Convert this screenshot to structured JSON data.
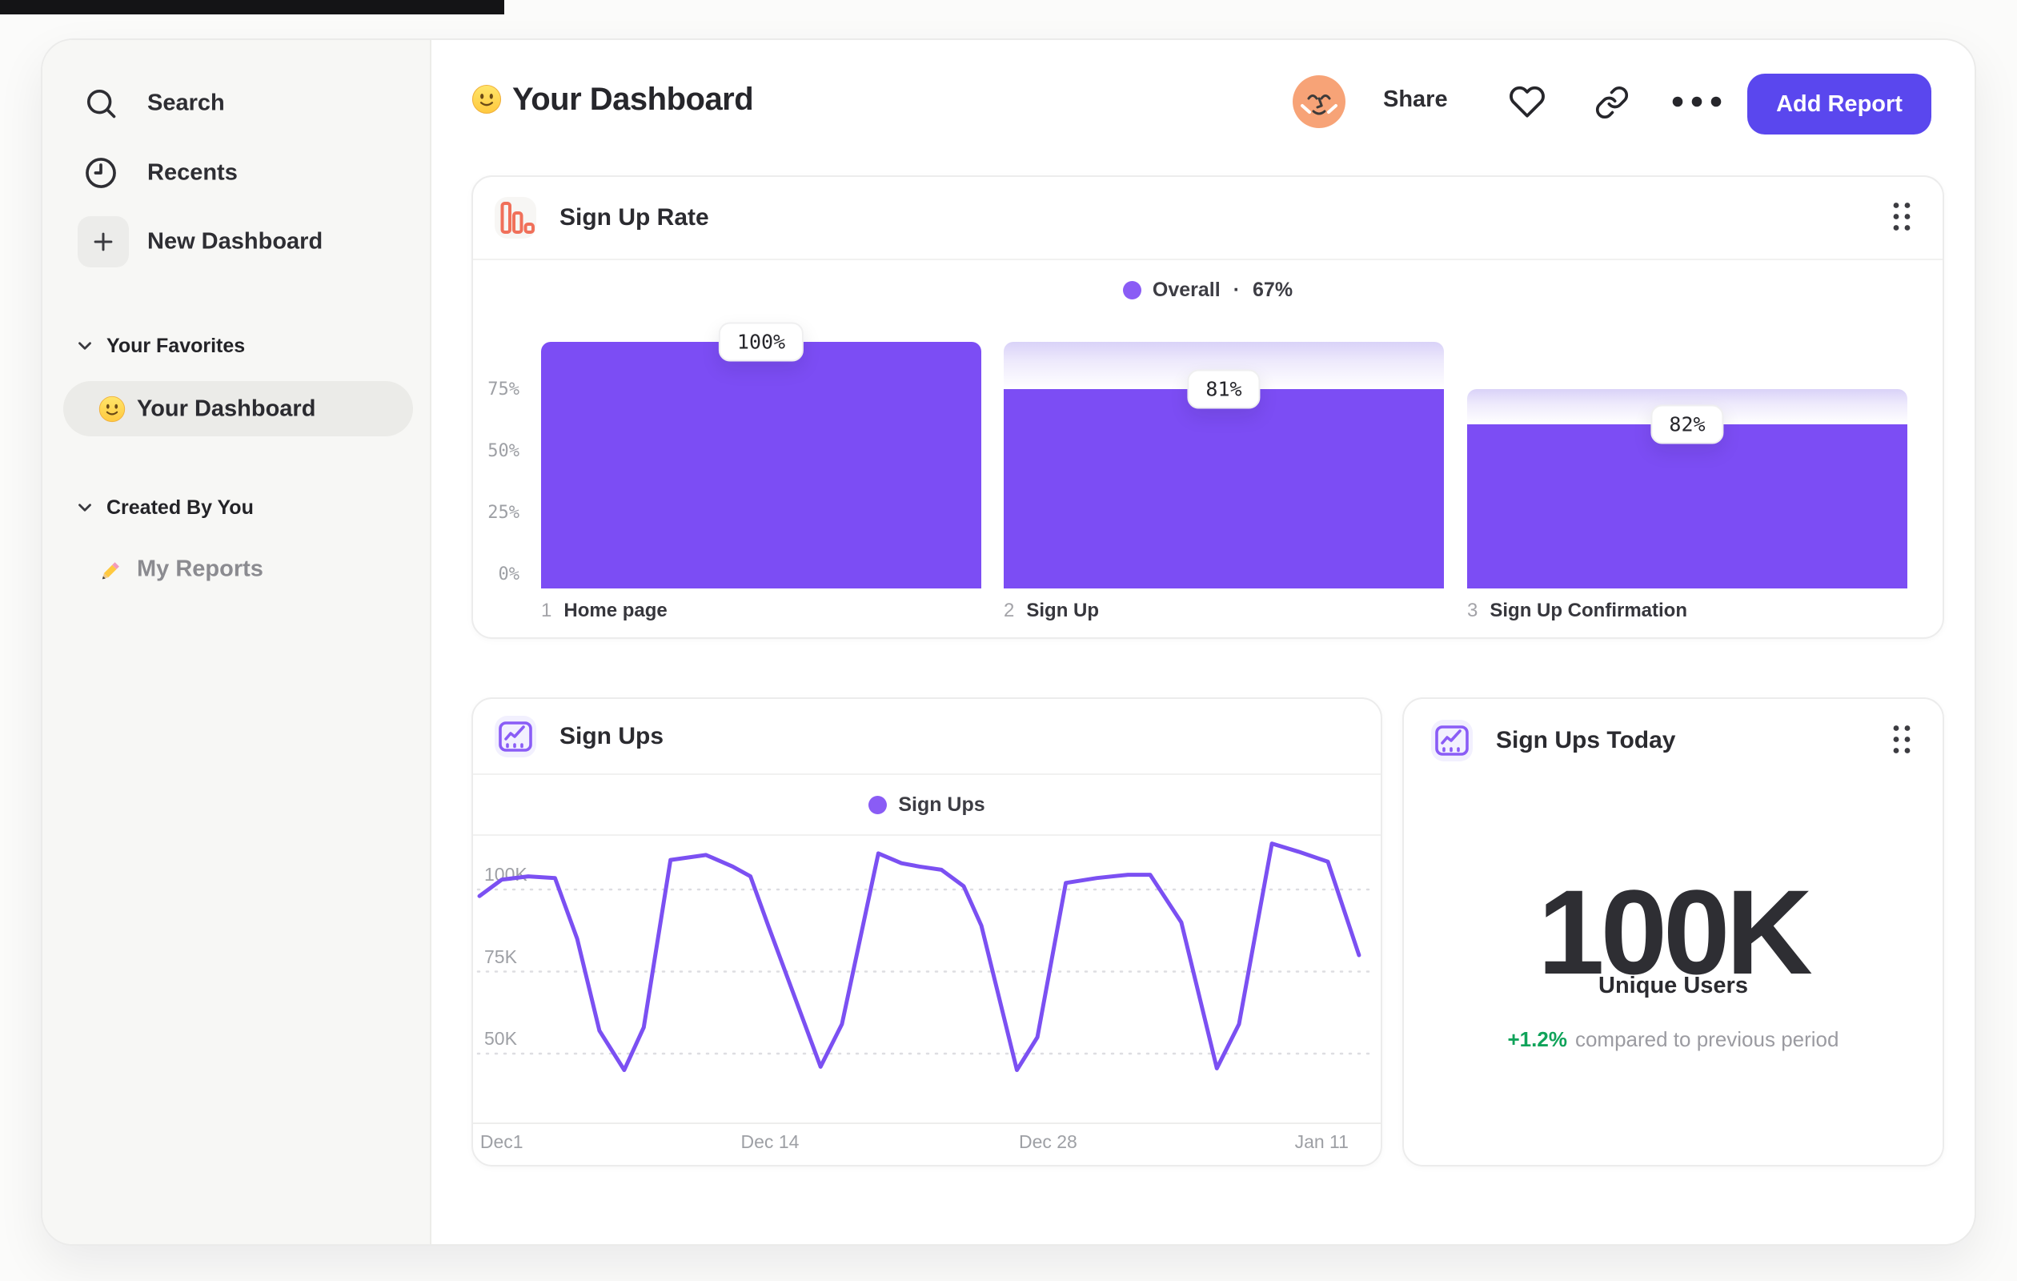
{
  "sidebar": {
    "search": "Search",
    "recents": "Recents",
    "new_dashboard": "New Dashboard",
    "sections": [
      {
        "title": "Your Favorites",
        "items": [
          {
            "label": "Your Dashboard",
            "icon": "slightly-smiling-face-emoji",
            "active": true
          }
        ]
      },
      {
        "title": "Created By You",
        "items": [
          {
            "label": "My Reports",
            "icon": "pencil-emoji",
            "active": false
          }
        ]
      }
    ]
  },
  "header": {
    "icon": "slightly-smiling-face-emoji",
    "title": "Your Dashboard",
    "share": "Share",
    "add_report": "Add Report"
  },
  "cards": {
    "sign_up_rate": {
      "title": "Sign Up Rate",
      "icon": "funnel-bars-icon",
      "legend_name": "Overall",
      "legend_separator": "·",
      "legend_value": "67%"
    },
    "sign_ups": {
      "title": "Sign Ups",
      "icon": "line-chart-icon",
      "legend_name": "Sign Ups"
    },
    "sign_ups_today": {
      "title": "Sign Ups Today",
      "icon": "line-chart-icon",
      "value": "100K",
      "label": "Unique Users",
      "delta": "+1.2%",
      "delta_caption": "compared to previous period"
    }
  },
  "colors": {
    "bar_purple": "#7C4DF4",
    "legend_dot_purple": "#8A5CF5",
    "button_purple": "#5A47EE",
    "funnel_icon_orange": "#F0705A",
    "line_icon_purple": "#8A5CF6",
    "positive_green": "#10A35A",
    "gradient_cap_top": "#D9D2F8",
    "avatar_peach": "#F7A377"
  },
  "chart_data": [
    {
      "type": "bar",
      "subtype": "funnel",
      "title": "Sign Up Rate",
      "legend": "Overall · 67%",
      "legend_position": "top-center",
      "overall_conversion_pct": 67,
      "categories": [
        "Home page",
        "Sign Up",
        "Sign Up Confirmation"
      ],
      "step_numbers": [
        "1",
        "2",
        "3"
      ],
      "step_conversion_pct": [
        100,
        81,
        82
      ],
      "value_labels": [
        "100%",
        "81%",
        "82%"
      ],
      "cumulative_pct": [
        100,
        81,
        66.4
      ],
      "ylim": [
        0,
        100
      ],
      "y_ticks": [
        {
          "label": "75%",
          "value": 75
        },
        {
          "label": "50%",
          "value": 50
        },
        {
          "label": "25%",
          "value": 25
        },
        {
          "label": "0%",
          "value": 0
        }
      ],
      "grid": false,
      "bar_color": "#7C4DF4"
    },
    {
      "type": "line",
      "title": "Sign Ups",
      "legend": "Sign Ups",
      "legend_position": "top-center",
      "line_color": "#7B50F2",
      "y_unit": "thousands",
      "ylim_k": [
        38,
        117
      ],
      "grid": "dotted-horizontal",
      "y_ticks": [
        {
          "label": "100K",
          "value": 100
        },
        {
          "label": "75K",
          "value": 75
        },
        {
          "label": "50K",
          "value": 50
        }
      ],
      "x_ticks": [
        {
          "label": "Dec1",
          "frac": 0.025
        },
        {
          "label": "Dec 14",
          "frac": 0.327
        },
        {
          "label": "Dec 28",
          "frac": 0.64
        },
        {
          "label": "Jan 11",
          "frac": 0.948
        }
      ],
      "points_frac_x_value_k": [
        [
          0,
          98
        ],
        [
          0.025,
          103
        ],
        [
          0.055,
          104
        ],
        [
          0.085,
          103.5
        ],
        [
          0.11,
          85
        ],
        [
          0.135,
          57
        ],
        [
          0.163,
          45
        ],
        [
          0.185,
          58
        ],
        [
          0.215,
          109
        ],
        [
          0.255,
          110.5
        ],
        [
          0.285,
          107
        ],
        [
          0.305,
          104
        ],
        [
          0.325,
          89
        ],
        [
          0.384,
          46
        ],
        [
          0.408,
          59
        ],
        [
          0.449,
          111
        ],
        [
          0.475,
          108
        ],
        [
          0.495,
          107
        ],
        [
          0.52,
          106
        ],
        [
          0.545,
          101
        ],
        [
          0.565,
          89
        ],
        [
          0.605,
          45
        ],
        [
          0.628,
          55
        ],
        [
          0.66,
          102
        ],
        [
          0.695,
          103.5
        ],
        [
          0.73,
          104.5
        ],
        [
          0.755,
          104.5
        ],
        [
          0.79,
          90
        ],
        [
          0.83,
          45.5
        ],
        [
          0.855,
          59
        ],
        [
          0.892,
          114
        ],
        [
          0.922,
          111.5
        ],
        [
          0.955,
          108.5
        ],
        [
          0.99,
          80
        ]
      ]
    }
  ]
}
